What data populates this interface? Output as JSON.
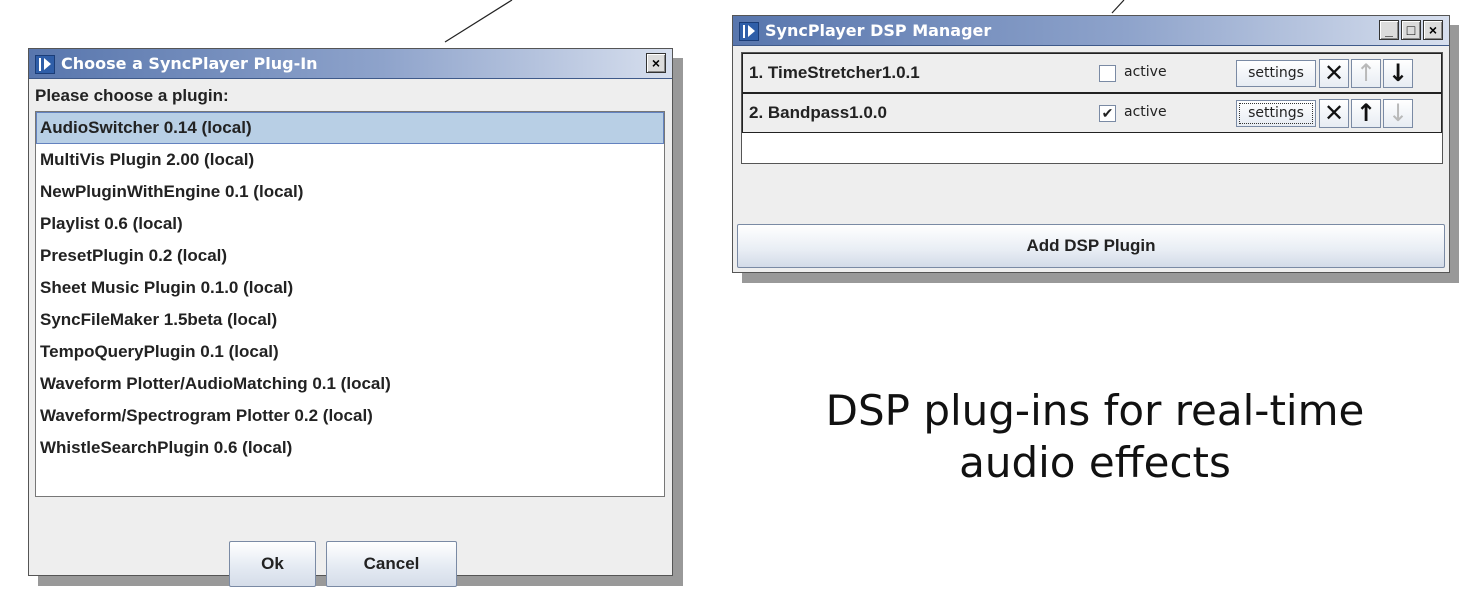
{
  "chooser": {
    "title": "Choose a SyncPlayer Plug-In",
    "close_glyph": "×",
    "prompt": "Please choose a plugin:",
    "plugins": [
      "AudioSwitcher 0.14 (local)",
      "MultiVis Plugin 2.00 (local)",
      "NewPluginWithEngine 0.1 (local)",
      "Playlist 0.6 (local)",
      "PresetPlugin 0.2 (local)",
      "Sheet Music Plugin 0.1.0 (local)",
      "SyncFileMaker 1.5beta (local)",
      "TempoQueryPlugin 0.1 (local)",
      "Waveform Plotter/AudioMatching 0.1 (local)",
      "Waveform/Spectrogram Plotter 0.2 (local)",
      "WhistleSearchPlugin 0.6 (local)"
    ],
    "selected_index": 0,
    "ok_label": "Ok",
    "cancel_label": "Cancel"
  },
  "dsp_manager": {
    "title": "SyncPlayer DSP Manager",
    "minimize_glyph": "_",
    "maximize_glyph": "□",
    "close_glyph": "×",
    "rows": [
      {
        "name": "1. TimeStretcher1.0.1",
        "active_label": "active",
        "active": false,
        "check_glyph": "",
        "settings_label": "settings",
        "remove_glyph": "✕",
        "up_glyph": "↑",
        "down_glyph": "↓",
        "up_enabled": false,
        "down_enabled": true
      },
      {
        "name": "2. Bandpass1.0.0",
        "active_label": "active",
        "active": true,
        "check_glyph": "✔",
        "settings_label": "settings",
        "remove_glyph": "✕",
        "up_glyph": "↑",
        "down_glyph": "↓",
        "up_enabled": true,
        "down_enabled": false
      }
    ],
    "add_label": "Add DSP Plugin"
  },
  "caption": {
    "line1": "DSP plug-ins for real-time",
    "line2": "audio effects"
  },
  "colors": {
    "title_gradient_start": "#5876ad",
    "title_gradient_end": "#d7dfee",
    "selection": "#b8cfe5",
    "window_bg": "#eeeeee",
    "shadow": "#999999"
  }
}
